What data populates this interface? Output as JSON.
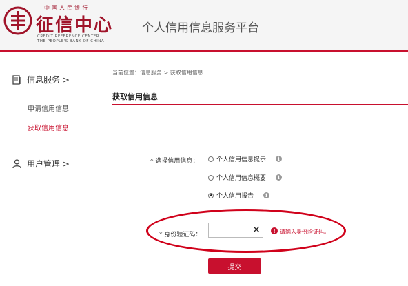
{
  "header": {
    "logo_top": "中国人民银行",
    "logo_cn": "征信中心",
    "logo_en_line1": "CREDIT REFERENCE CENTER",
    "logo_en_line2": "THE PEOPLE'S BANK OF CHINA",
    "platform_title": "个人信用信息服务平台",
    "brand_color": "#c8102e"
  },
  "sidebar": {
    "info_service": {
      "label": "信息服务 >",
      "icon": "document-icon"
    },
    "items": [
      {
        "label": "申请信用信息",
        "active": false
      },
      {
        "label": "获取信用信息",
        "active": true
      }
    ],
    "user_management": {
      "label": "用户管理 >",
      "icon": "user-icon"
    }
  },
  "main": {
    "breadcrumb": "当前位置：信息服务 > 获取信用信息",
    "section_title": "获取信用信息",
    "select_label": "* 选择信用信息：",
    "options": [
      {
        "label": "个人信用信息提示",
        "checked": false
      },
      {
        "label": "个人信用信息概要",
        "checked": false
      },
      {
        "label": "个人信用报告",
        "checked": true
      }
    ],
    "id_code_label": "* 身份验证码：",
    "id_code_value": "",
    "clear_symbol": "✕",
    "error_message": "请输入身份验证码。",
    "submit_label": "提交"
  }
}
